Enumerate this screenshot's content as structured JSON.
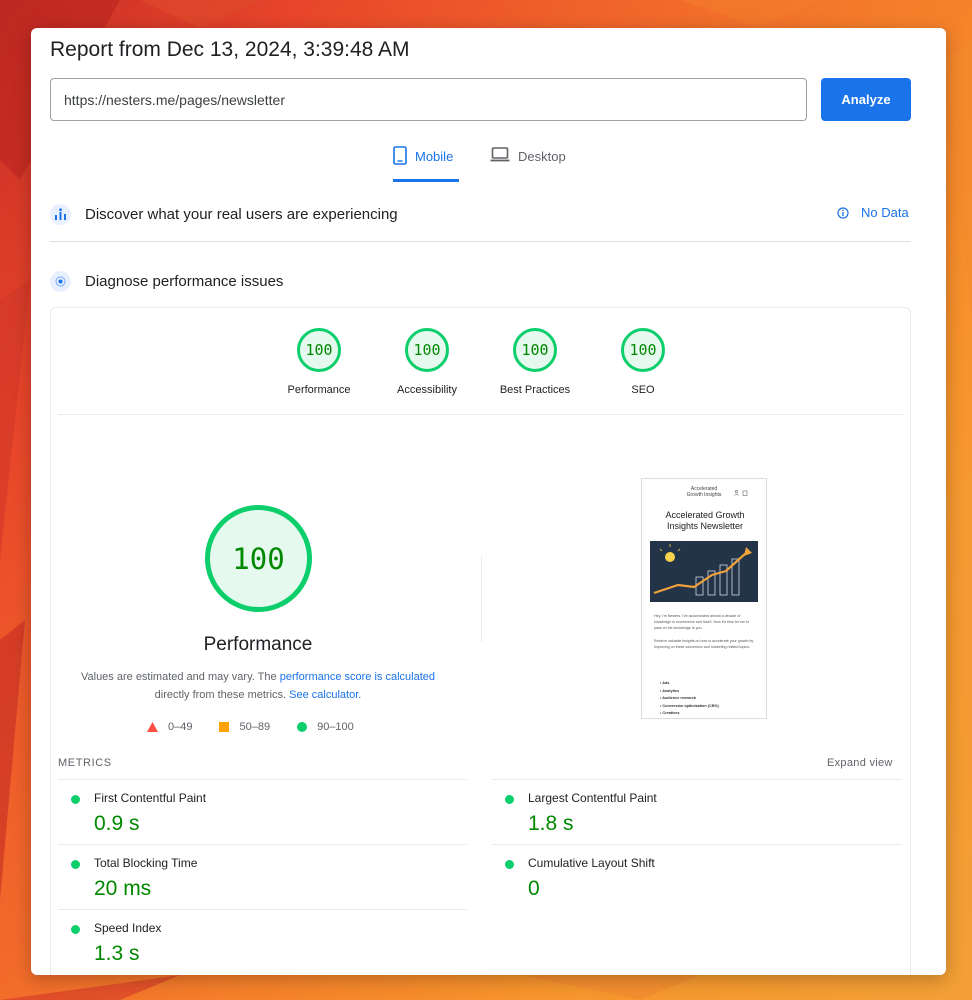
{
  "report": {
    "title": "Report from Dec 13, 2024, 3:39:48 AM",
    "url_value": "https://nesters.me/pages/newsletter",
    "analyze_label": "Analyze"
  },
  "tabs": [
    {
      "label": "Mobile",
      "icon": "smartphone-icon",
      "active": true
    },
    {
      "label": "Desktop",
      "icon": "laptop-icon",
      "active": false
    }
  ],
  "field_data": {
    "title": "Discover what your real users are experiencing",
    "status": "No Data"
  },
  "diagnose": {
    "title": "Diagnose performance issues"
  },
  "scores": [
    {
      "label": "Performance",
      "value": "100"
    },
    {
      "label": "Accessibility",
      "value": "100"
    },
    {
      "label": "Best Practices",
      "value": "100"
    },
    {
      "label": "SEO",
      "value": "100"
    }
  ],
  "performance": {
    "score": "100",
    "title": "Performance",
    "note_prefix": "Values are estimated and may vary. The ",
    "note_link1": "performance score is calculated",
    "note_middle": " directly from these metrics. ",
    "note_link2": "See calculator.",
    "legend": [
      {
        "range": "0–49",
        "color": "#ff4e42",
        "shape": "triangle"
      },
      {
        "range": "50–89",
        "color": "#ffa400",
        "shape": "square"
      },
      {
        "range": "90–100",
        "color": "#0cce6b",
        "shape": "circle"
      }
    ]
  },
  "screenshot_preview": {
    "header": "Accelerated\nGrowth Insights",
    "title": "Accelerated Growth Insights Newsletter",
    "paragraph1": "Hey, I'm Nesters. I've accumulated almost a decade of knowledge in ecommerce and SaaS. Now it's time for me to pass on the knowledge to you.",
    "paragraph2": "Receive valuable insights on how to accelerate your growth by improving on these conversion and marketing related topics:",
    "topics": [
      "Ads",
      "Analytics",
      "Audience research",
      "Conversion optimization (CRO)",
      "Creatives"
    ]
  },
  "metrics": {
    "label": "METRICS",
    "expand_label": "Expand view",
    "items": [
      {
        "name": "First Contentful Paint",
        "value": "0.9 s"
      },
      {
        "name": "Largest Contentful Paint",
        "value": "1.8 s"
      },
      {
        "name": "Total Blocking Time",
        "value": "20 ms"
      },
      {
        "name": "Cumulative Layout Shift",
        "value": "0"
      },
      {
        "name": "Speed Index",
        "value": "1.3 s"
      }
    ]
  },
  "colors": {
    "accent": "#1a73e8",
    "pass": "#0cce6b",
    "pass_text": "#008800"
  }
}
